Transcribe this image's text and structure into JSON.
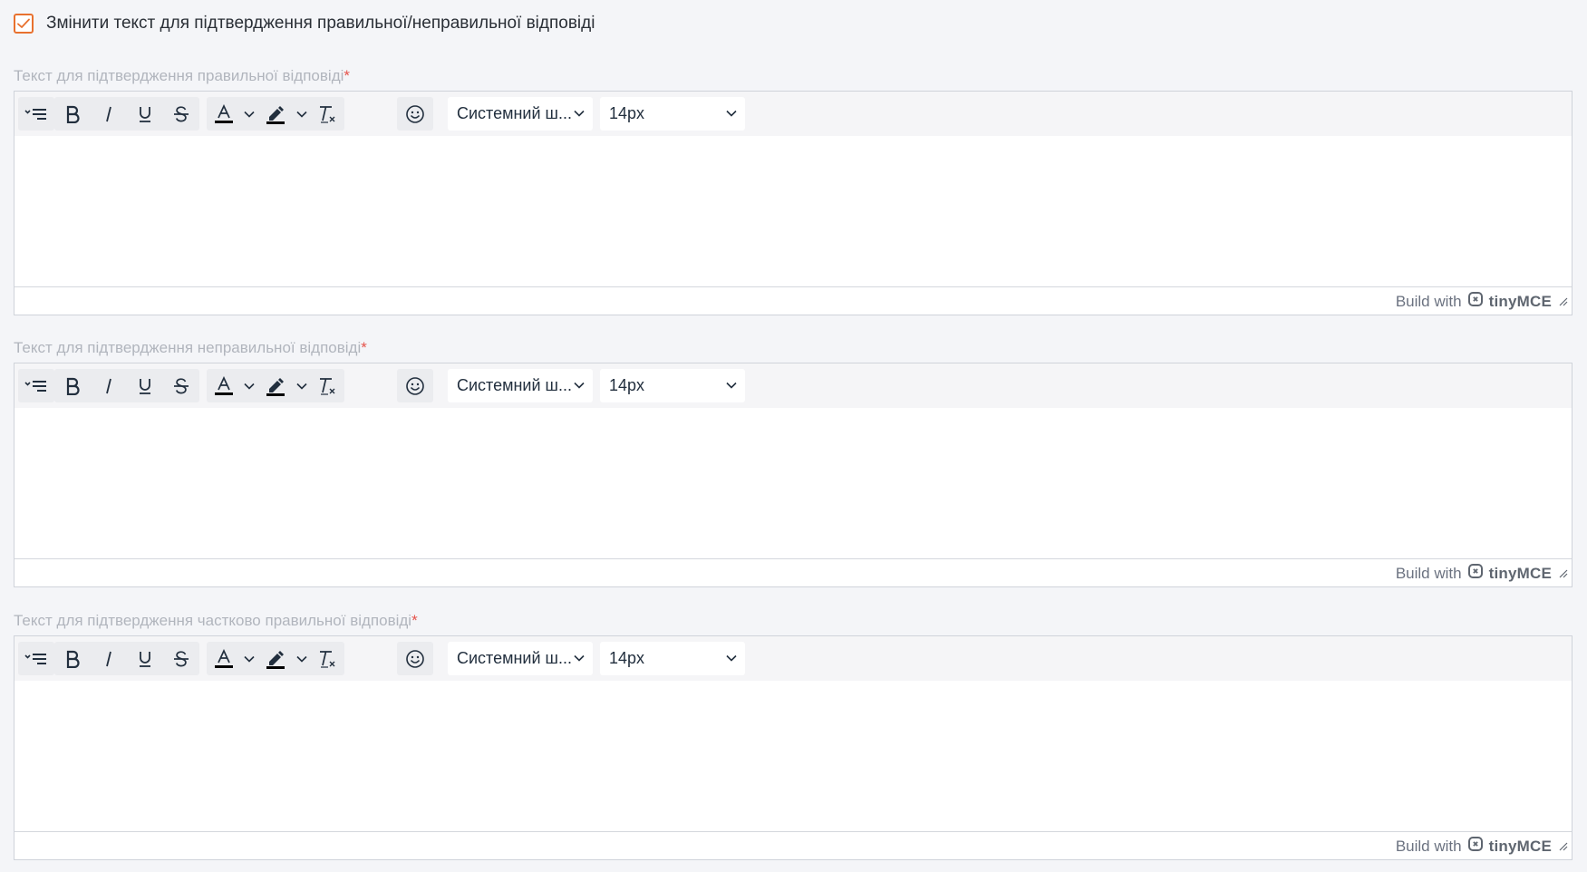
{
  "toggle": {
    "checked": true,
    "label": "Змінити текст для підтвердження правильної/неправильної відповіді"
  },
  "editors": [
    {
      "label": "Текст для підтвердження правильної відповіді",
      "required_mark": "*",
      "font_family": "Системний ш...",
      "font_size": "14px",
      "content": "",
      "branding_prefix": "Build with",
      "branding_name": "tinyMCE"
    },
    {
      "label": "Текст для підтвердження неправильної відповіді",
      "required_mark": "*",
      "font_family": "Системний ш...",
      "font_size": "14px",
      "content": "",
      "branding_prefix": "Build with",
      "branding_name": "tinyMCE"
    },
    {
      "label": "Текст для підтвердження частково правильної відповіді",
      "required_mark": "*",
      "font_family": "Системний ш...",
      "font_size": "14px",
      "content": "",
      "branding_prefix": "Build with",
      "branding_name": "tinyMCE"
    }
  ],
  "toolbar_icons": [
    "align-icon",
    "bold-icon",
    "italic-icon",
    "underline-icon",
    "strikethrough-icon",
    "text-color-icon",
    "highlight-icon",
    "clear-format-icon",
    "emoji-icon"
  ],
  "colors": {
    "accent": "#e8712f",
    "required": "#e5534b",
    "label": "#b1b5bd"
  }
}
